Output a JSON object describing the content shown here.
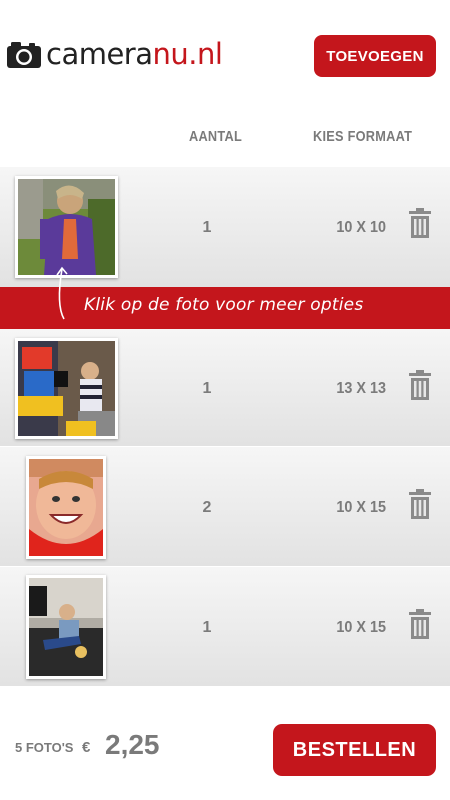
{
  "header": {
    "logo_part1": "camera",
    "logo_part2": "nu.nl",
    "add_label": "TOEVOEGEN"
  },
  "columns": {
    "quantity": "AANTAL",
    "format": "KIES FORMAAT"
  },
  "hint": "Klik op de foto voor meer opties",
  "items": [
    {
      "quantity": "1",
      "format": "10 X 10"
    },
    {
      "quantity": "1",
      "format": "13 X 13"
    },
    {
      "quantity": "2",
      "format": "10 X 15"
    },
    {
      "quantity": "1",
      "format": "10 X 15"
    }
  ],
  "footer": {
    "photo_count": "5 FOTO'S",
    "currency": "€",
    "total": "2,25",
    "order_label": "BESTELLEN"
  },
  "colors": {
    "accent": "#c4161c",
    "text_gray": "#7a7a7a"
  }
}
